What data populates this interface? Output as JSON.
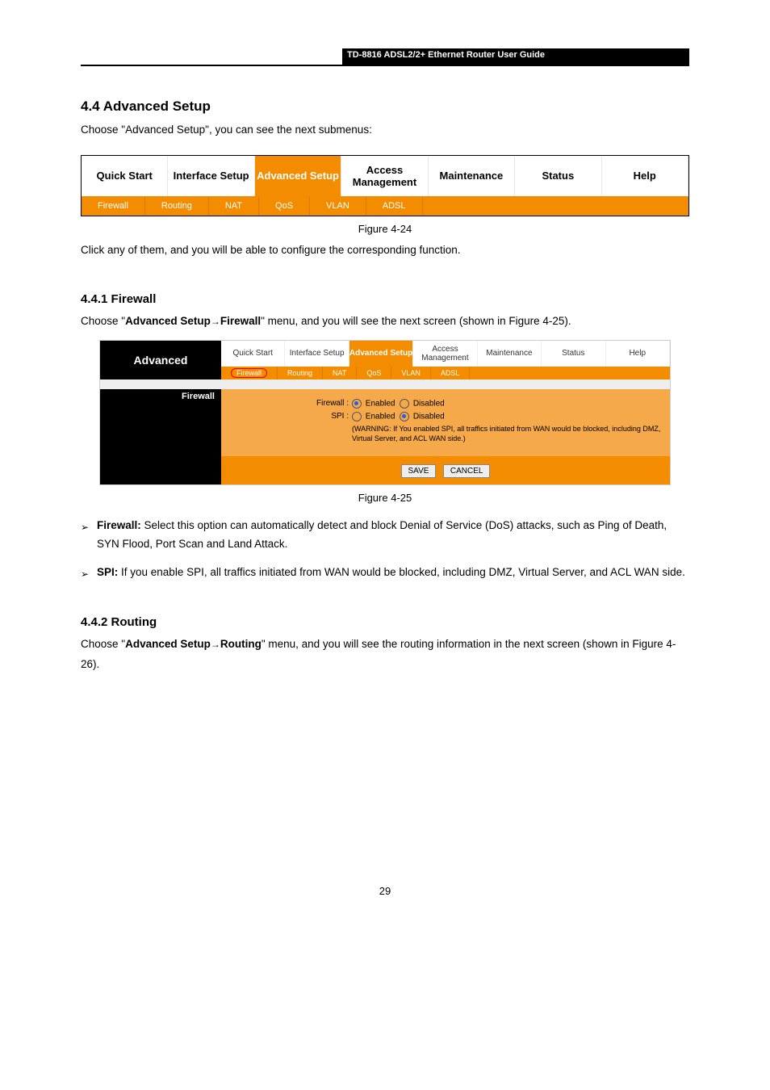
{
  "header": {
    "title": "TD-8816 ADSL2/2+ Ethernet Router User Guide"
  },
  "section": {
    "title": "4.4 Advanced Setup",
    "intro": "Choose \"Advanced Setup\", you can see the next submenus:"
  },
  "tabs_big": {
    "row1": [
      "Quick Start",
      "Interface Setup",
      "Advanced Setup",
      "Access Management",
      "Maintenance",
      "Status",
      "Help"
    ],
    "selected_index": 2,
    "row2": [
      "Firewall",
      "Routing",
      "NAT",
      "QoS",
      "VLAN",
      "ADSL"
    ]
  },
  "figure_caption_1": "Figure 4-24",
  "after_tabs_1": "Click any of them, and you will be able to configure the corresponding function.",
  "subsection": {
    "title": "4.4.1 Firewall",
    "path_prefix": "Choose \"",
    "path_bold1": "Advanced Setup",
    "path_arrow": "→",
    "path_bold2": "Firewall",
    "path_suffix": "\" menu, and you will see the next screen (shown in Figure 4-25)."
  },
  "screenshot": {
    "side": "Advanced",
    "tabs_r1": [
      "Quick Start",
      "Interface Setup",
      "Advanced Setup",
      "Access Management",
      "Maintenance",
      "Status",
      "Help"
    ],
    "tabs_sel": 2,
    "tabs_r2": [
      "Firewall",
      "Routing",
      "NAT",
      "QoS",
      "VLAN",
      "ADSL"
    ],
    "section_label": "Firewall",
    "f1": {
      "label": "Firewall :",
      "opt1": "Enabled",
      "opt2": "Disabled"
    },
    "f2": {
      "label": "SPI :",
      "opt1": "Enabled",
      "opt2": "Disabled"
    },
    "warning": "(WARNING: If You enabled SPI, all traffics initiated from WAN would be blocked, including DMZ, Virtual Server, and ACL WAN side.)",
    "btn_save": "SAVE",
    "btn_cancel": "CANCEL"
  },
  "figure_caption_2": "Figure 4-25",
  "bullets": {
    "b1_label": "Firewall:",
    "b1_text": " Select this option can automatically detect and block Denial of Service (DoS) attacks, such as Ping of Death, SYN Flood, Port Scan and Land Attack.",
    "b2_label": "SPI:",
    "b2_text": " If you enable SPI, all traffics initiated from WAN would be blocked, including DMZ, Virtual Server, and ACL WAN side."
  },
  "section2": {
    "title": "4.4.2 Routing",
    "path_prefix": "Choose \"",
    "path_bold1": "Advanced Setup",
    "path_arrow": "→",
    "path_bold2": "Routing",
    "path_suffix": "\" menu, and you will see the routing information in the next screen (shown in Figure 4-26)."
  },
  "page_number": "29"
}
